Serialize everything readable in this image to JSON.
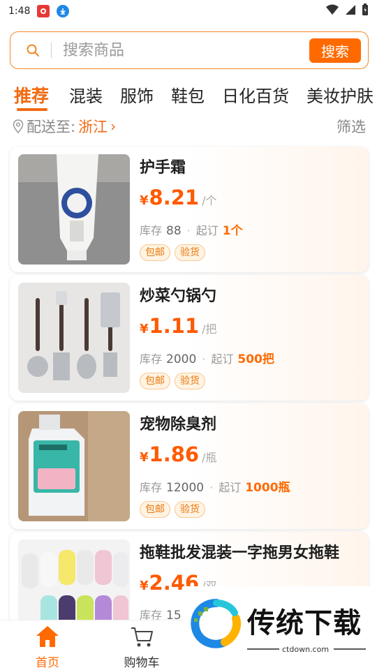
{
  "status_bar": {
    "time": "1:48",
    "icons": [
      "app-notification-icon",
      "download-icon",
      "wifi-icon",
      "signal-icon",
      "battery-icon"
    ]
  },
  "search": {
    "placeholder": "搜索商品",
    "button_label": "搜索"
  },
  "categories": [
    "推荐",
    "混装",
    "服饰",
    "鞋包",
    "日化百货",
    "美妆护肤"
  ],
  "active_category": "推荐",
  "location": {
    "label": "配送至:",
    "value": "浙江",
    "chevron": "›",
    "filter_label": "筛选"
  },
  "labels": {
    "stock": "库存",
    "moq": "起订",
    "currency": "¥"
  },
  "products": [
    {
      "name": "护手霜",
      "price": "8.21",
      "unit": "/个",
      "stock": "88",
      "moq": "1个",
      "tags": [
        "包邮",
        "验货"
      ]
    },
    {
      "name": "炒菜勺锅勺",
      "price": "1.11",
      "unit": "/把",
      "stock": "2000",
      "moq": "500把",
      "tags": [
        "包邮",
        "验货"
      ]
    },
    {
      "name": "宠物除臭剂",
      "price": "1.86",
      "unit": "/瓶",
      "stock": "12000",
      "moq": "1000瓶",
      "tags": [
        "包邮",
        "验货"
      ]
    },
    {
      "name": "拖鞋批发混装一字拖男女拖鞋",
      "price": "2.46",
      "unit": "/双",
      "stock": "15",
      "moq": "",
      "tags": []
    }
  ],
  "bottom_nav": [
    {
      "label": "首页",
      "icon": "home-icon",
      "active": true
    },
    {
      "label": "购物车",
      "icon": "cart-icon",
      "active": false
    }
  ],
  "watermark": {
    "text": "传统下载",
    "sub": "ctdown.com"
  },
  "colors": {
    "accent": "#ff6a00",
    "price": "#ff5a00",
    "tag_text": "#e8780e"
  }
}
